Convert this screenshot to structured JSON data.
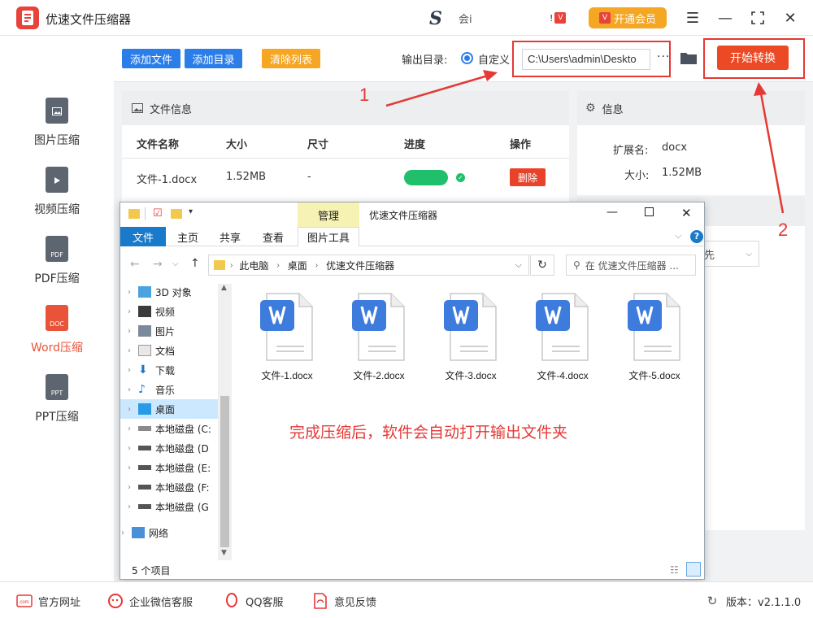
{
  "app": {
    "title": "优速文件压缩器",
    "promo_text": "会i",
    "vip_label": "开通会员"
  },
  "sidebar": {
    "items": [
      {
        "label": "图片压缩",
        "icon_text": ""
      },
      {
        "label": "视频压缩",
        "icon_text": ""
      },
      {
        "label": "PDF压缩",
        "icon_text": "PDF"
      },
      {
        "label": "Word压缩",
        "icon_text": "DOC"
      },
      {
        "label": "PPT压缩",
        "icon_text": "PPT"
      }
    ]
  },
  "toolbar": {
    "add_file": "添加文件",
    "add_folder": "添加目录",
    "clear_list": "清除列表",
    "output_label": "输出目录:",
    "custom_label": "自定义",
    "output_path": "C:\\Users\\admin\\Deskto",
    "more": "···",
    "start": "开始转换"
  },
  "file_panel": {
    "title": "文件信息",
    "columns": [
      "文件名称",
      "大小",
      "尺寸",
      "进度",
      "操作"
    ],
    "row": {
      "name": "文件-1.docx",
      "size": "1.52MB",
      "dims": "-",
      "progress": 1.0,
      "delete": "删除"
    }
  },
  "info_panel": {
    "title": "信息",
    "ext_label": "扩展名:",
    "ext_value": "docx",
    "size_label": "大小:",
    "size_value": "1.52MB",
    "select_partial": "先"
  },
  "annotations": {
    "one": "1",
    "two": "2"
  },
  "explorer": {
    "title": "优速文件压缩器",
    "manage_tab": "管理",
    "tabs": [
      "文件",
      "主页",
      "共享",
      "查看"
    ],
    "tool_tab": "图片工具",
    "address": [
      "此电脑",
      "桌面",
      "优速文件压缩器"
    ],
    "search_placeholder": "在 优速文件压缩器 ...",
    "nav": [
      {
        "label": "3D 对象",
        "icon": "cube-icon"
      },
      {
        "label": "视频",
        "icon": "video-icon"
      },
      {
        "label": "图片",
        "icon": "picture-icon"
      },
      {
        "label": "文档",
        "icon": "document-icon"
      },
      {
        "label": "下载",
        "icon": "download-icon"
      },
      {
        "label": "音乐",
        "icon": "music-icon"
      },
      {
        "label": "桌面",
        "icon": "desktop-icon"
      },
      {
        "label": "本地磁盘 (C:",
        "icon": "disk-icon"
      },
      {
        "label": "本地磁盘 (D",
        "icon": "disk-icon"
      },
      {
        "label": "本地磁盘 (E:",
        "icon": "disk-icon"
      },
      {
        "label": "本地磁盘 (F:",
        "icon": "disk-icon"
      },
      {
        "label": "本地磁盘 (G",
        "icon": "disk-icon"
      },
      {
        "label": "网络",
        "icon": "network-icon"
      }
    ],
    "files": [
      "文件-1.docx",
      "文件-2.docx",
      "文件-3.docx",
      "文件-4.docx",
      "文件-5.docx"
    ],
    "notice": "完成压缩后，软件会自动打开输出文件夹",
    "status": "5 个项目"
  },
  "bottom": {
    "website": "官方网址",
    "wechat": "企业微信客服",
    "qq": "QQ客服",
    "feedback": "意见反馈",
    "version": "版本：v2.1.1.0"
  },
  "colors": {
    "accent": "#ec4a24",
    "blue": "#2b7de9",
    "green": "#1fbf6b",
    "orange": "#f5a623"
  }
}
